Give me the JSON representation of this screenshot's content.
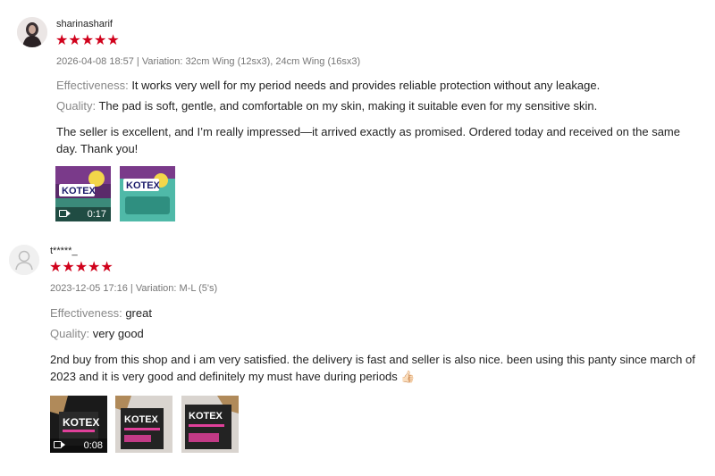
{
  "reviews": [
    {
      "username": "sharinasharif",
      "stars": "★★★★★",
      "meta": "2026-04-08 18:57 | Variation: 32cm Wing (12sx3), 24cm Wing (16sx3)",
      "effectiveness_label": "Effectiveness:",
      "effectiveness_value": " It works very well for my period needs and provides reliable protection without any leakage.",
      "quality_label": "Quality:",
      "quality_value": " The pad is soft, gentle, and comfortable on my skin, making it suitable even for my sensitive skin.",
      "comment": "The seller is excellent, and I’m really impressed—it arrived exactly as promised. Ordered today and received on the same day. Thank you!",
      "media": [
        {
          "type": "video",
          "duration": "0:17",
          "brand": "KOTEX"
        },
        {
          "type": "image",
          "brand": "KOTEX"
        }
      ]
    },
    {
      "username": "t*****_",
      "stars": "★★★★★",
      "meta": "2023-12-05 17:16 | Variation: M-L (5's)",
      "effectiveness_label": "Effectiveness:",
      "effectiveness_value": " great",
      "quality_label": "Quality:",
      "quality_value": " very good",
      "comment": "2nd buy from this shop and i am very satisfied. the delivery is fast and seller is also nice. been using this panty since march of 2023 and it is very good and definitely my must have during periods 👍🏻",
      "media": [
        {
          "type": "video",
          "duration": "0:08",
          "brand": "KOTEX"
        },
        {
          "type": "image",
          "brand": "KOTEX"
        },
        {
          "type": "image",
          "brand": "KOTEX"
        }
      ]
    }
  ],
  "colors": {
    "star": "#d0011b",
    "label": "#888888",
    "meta": "#777777"
  }
}
